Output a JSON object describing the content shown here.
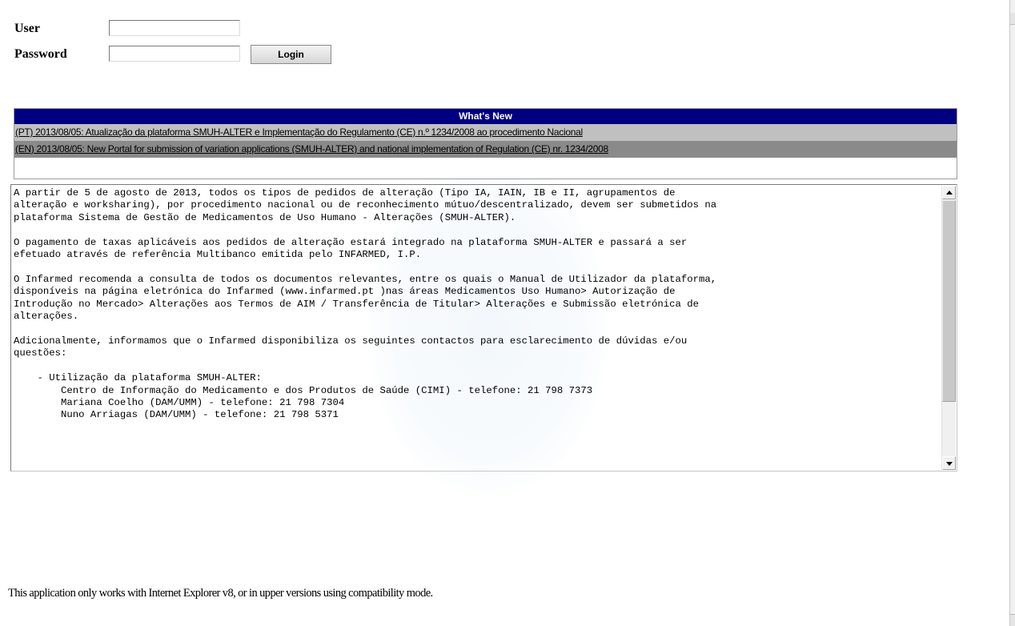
{
  "login": {
    "user_label": "User",
    "password_label": "Password",
    "user_value": "",
    "password_value": "",
    "button_label": "Login"
  },
  "news": {
    "header": "What's New",
    "items": [
      "(PT) 2013/08/05: Atualização da plataforma SMUH-ALTER e Implementação do Regulamento (CE) n.º 1234/2008 ao procedimento Nacional",
      "(EN) 2013/08/05: New Portal for submission of variation applications (SMUH-ALTER) and national implementation of Regulation (CE) nr. 1234/2008"
    ],
    "details_text": "A partir de 5 de agosto de 2013, todos os tipos de pedidos de alteração (Tipo IA, IAIN, IB e II, agrupamentos de\nalteração e worksharing), por procedimento nacional ou de reconhecimento mútuo/descentralizado, devem ser submetidos na\nplataforma Sistema de Gestão de Medicamentos de Uso Humano - Alterações (SMUH-ALTER).\n\nO pagamento de taxas aplicáveis aos pedidos de alteração estará integrado na plataforma SMUH-ALTER e passará a ser\nefetuado através de referência Multibanco emitida pelo INFARMED, I.P.\n\nO Infarmed recomenda a consulta de todos os documentos relevantes, entre os quais o Manual de Utilizador da plataforma,\ndisponíveis na página eletrónica do Infarmed (www.infarmed.pt )nas áreas Medicamentos Uso Humano> Autorização de\nIntrodução no Mercado> Alterações aos Termos de AIM / Transferência de Titular> Alterações e Submissão eletrónica de\nalterações.\n\nAdicionalmente, informamos que o Infarmed disponibiliza os seguintes contactos para esclarecimento de dúvidas e/ou\nquestões:\n\n    - Utilização da plataforma SMUH-ALTER:\n        Centro de Informação do Medicamento e dos Produtos de Saúde (CIMI) - telefone: 21 798 7373\n        Mariana Coelho (DAM/UMM) - telefone: 21 798 7304\n        Nuno Arriagas (DAM/UMM) - telefone: 21 798 5371"
  },
  "footer": {
    "note": "This application only works with Internet Explorer v8, or in upper versions using compatibility mode."
  },
  "colors": {
    "news_header_bg": "#000080",
    "news_row_pt_bg": "#c0c0c0",
    "news_row_en_bg": "#8a8a8a"
  },
  "icons": [
    "scroll-up-arrow-icon",
    "scroll-down-arrow-icon"
  ]
}
